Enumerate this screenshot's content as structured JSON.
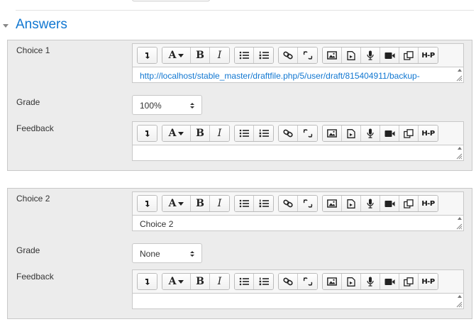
{
  "section": {
    "title": "Answers"
  },
  "choices": [
    {
      "label": "Choice 1",
      "content": "http://localhost/stable_master/draftfile.php/5/user/draft/815404911/backup-",
      "content_is_link": true,
      "grade_label": "Grade",
      "grade_value": "100%",
      "feedback_label": "Feedback",
      "feedback_value": ""
    },
    {
      "label": "Choice 2",
      "content": "Choice 2",
      "content_is_link": false,
      "grade_label": "Grade",
      "grade_value": "None",
      "feedback_label": "Feedback",
      "feedback_value": ""
    }
  ],
  "toolbar": {
    "groups": [
      [
        "show-more-icon"
      ],
      [
        "font-style-icon",
        "bold-icon",
        "italic-icon"
      ],
      [
        "unordered-list-icon",
        "ordered-list-icon"
      ],
      [
        "link-icon",
        "unlink-icon"
      ],
      [
        "image-icon",
        "media-icon",
        "record-audio-icon",
        "record-video-icon",
        "manage-files-icon",
        "h5p-icon"
      ]
    ],
    "font_glyph": "A",
    "bold_glyph": "B",
    "italic_glyph": "I",
    "h5p_glyph": "H-P"
  },
  "colors": {
    "accent": "#1177d1",
    "panel": "#ececec",
    "border": "#c8c8c8"
  }
}
